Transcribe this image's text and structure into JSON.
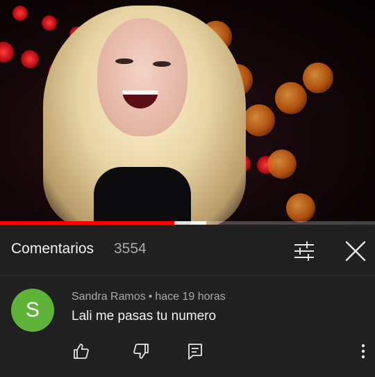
{
  "comments": {
    "title": "Comentarios",
    "count": "3554"
  },
  "video": {
    "progress": 0.465,
    "buffered": 0.55
  },
  "comment": {
    "avatar_letter": "S",
    "avatar_color": "#5fb338",
    "author": "Sandra Ramos",
    "separator": "•",
    "time": "hace 19 horas",
    "text": "Lali me pasas tu numero"
  },
  "icons": {
    "filter": "sort-filter-icon",
    "close": "close-icon",
    "like": "thumbs-up-icon",
    "dislike": "thumbs-down-icon",
    "reply": "reply-icon",
    "more": "more-vertical-icon"
  },
  "colors": {
    "background": "#212121",
    "progress": "#ff0000",
    "secondary_text": "#aaaaaa"
  }
}
